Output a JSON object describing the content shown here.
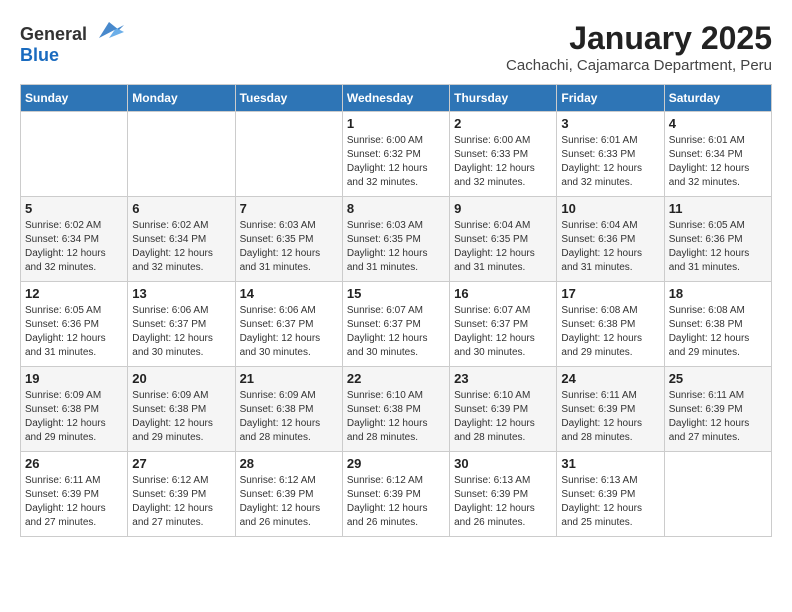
{
  "header": {
    "logo_general": "General",
    "logo_blue": "Blue",
    "month_title": "January 2025",
    "location": "Cachachi, Cajamarca Department, Peru"
  },
  "days_of_week": [
    "Sunday",
    "Monday",
    "Tuesday",
    "Wednesday",
    "Thursday",
    "Friday",
    "Saturday"
  ],
  "weeks": [
    [
      {
        "day": "",
        "info": ""
      },
      {
        "day": "",
        "info": ""
      },
      {
        "day": "",
        "info": ""
      },
      {
        "day": "1",
        "info": "Sunrise: 6:00 AM\nSunset: 6:32 PM\nDaylight: 12 hours\nand 32 minutes."
      },
      {
        "day": "2",
        "info": "Sunrise: 6:00 AM\nSunset: 6:33 PM\nDaylight: 12 hours\nand 32 minutes."
      },
      {
        "day": "3",
        "info": "Sunrise: 6:01 AM\nSunset: 6:33 PM\nDaylight: 12 hours\nand 32 minutes."
      },
      {
        "day": "4",
        "info": "Sunrise: 6:01 AM\nSunset: 6:34 PM\nDaylight: 12 hours\nand 32 minutes."
      }
    ],
    [
      {
        "day": "5",
        "info": "Sunrise: 6:02 AM\nSunset: 6:34 PM\nDaylight: 12 hours\nand 32 minutes."
      },
      {
        "day": "6",
        "info": "Sunrise: 6:02 AM\nSunset: 6:34 PM\nDaylight: 12 hours\nand 32 minutes."
      },
      {
        "day": "7",
        "info": "Sunrise: 6:03 AM\nSunset: 6:35 PM\nDaylight: 12 hours\nand 31 minutes."
      },
      {
        "day": "8",
        "info": "Sunrise: 6:03 AM\nSunset: 6:35 PM\nDaylight: 12 hours\nand 31 minutes."
      },
      {
        "day": "9",
        "info": "Sunrise: 6:04 AM\nSunset: 6:35 PM\nDaylight: 12 hours\nand 31 minutes."
      },
      {
        "day": "10",
        "info": "Sunrise: 6:04 AM\nSunset: 6:36 PM\nDaylight: 12 hours\nand 31 minutes."
      },
      {
        "day": "11",
        "info": "Sunrise: 6:05 AM\nSunset: 6:36 PM\nDaylight: 12 hours\nand 31 minutes."
      }
    ],
    [
      {
        "day": "12",
        "info": "Sunrise: 6:05 AM\nSunset: 6:36 PM\nDaylight: 12 hours\nand 31 minutes."
      },
      {
        "day": "13",
        "info": "Sunrise: 6:06 AM\nSunset: 6:37 PM\nDaylight: 12 hours\nand 30 minutes."
      },
      {
        "day": "14",
        "info": "Sunrise: 6:06 AM\nSunset: 6:37 PM\nDaylight: 12 hours\nand 30 minutes."
      },
      {
        "day": "15",
        "info": "Sunrise: 6:07 AM\nSunset: 6:37 PM\nDaylight: 12 hours\nand 30 minutes."
      },
      {
        "day": "16",
        "info": "Sunrise: 6:07 AM\nSunset: 6:37 PM\nDaylight: 12 hours\nand 30 minutes."
      },
      {
        "day": "17",
        "info": "Sunrise: 6:08 AM\nSunset: 6:38 PM\nDaylight: 12 hours\nand 29 minutes."
      },
      {
        "day": "18",
        "info": "Sunrise: 6:08 AM\nSunset: 6:38 PM\nDaylight: 12 hours\nand 29 minutes."
      }
    ],
    [
      {
        "day": "19",
        "info": "Sunrise: 6:09 AM\nSunset: 6:38 PM\nDaylight: 12 hours\nand 29 minutes."
      },
      {
        "day": "20",
        "info": "Sunrise: 6:09 AM\nSunset: 6:38 PM\nDaylight: 12 hours\nand 29 minutes."
      },
      {
        "day": "21",
        "info": "Sunrise: 6:09 AM\nSunset: 6:38 PM\nDaylight: 12 hours\nand 28 minutes."
      },
      {
        "day": "22",
        "info": "Sunrise: 6:10 AM\nSunset: 6:38 PM\nDaylight: 12 hours\nand 28 minutes."
      },
      {
        "day": "23",
        "info": "Sunrise: 6:10 AM\nSunset: 6:39 PM\nDaylight: 12 hours\nand 28 minutes."
      },
      {
        "day": "24",
        "info": "Sunrise: 6:11 AM\nSunset: 6:39 PM\nDaylight: 12 hours\nand 28 minutes."
      },
      {
        "day": "25",
        "info": "Sunrise: 6:11 AM\nSunset: 6:39 PM\nDaylight: 12 hours\nand 27 minutes."
      }
    ],
    [
      {
        "day": "26",
        "info": "Sunrise: 6:11 AM\nSunset: 6:39 PM\nDaylight: 12 hours\nand 27 minutes."
      },
      {
        "day": "27",
        "info": "Sunrise: 6:12 AM\nSunset: 6:39 PM\nDaylight: 12 hours\nand 27 minutes."
      },
      {
        "day": "28",
        "info": "Sunrise: 6:12 AM\nSunset: 6:39 PM\nDaylight: 12 hours\nand 26 minutes."
      },
      {
        "day": "29",
        "info": "Sunrise: 6:12 AM\nSunset: 6:39 PM\nDaylight: 12 hours\nand 26 minutes."
      },
      {
        "day": "30",
        "info": "Sunrise: 6:13 AM\nSunset: 6:39 PM\nDaylight: 12 hours\nand 26 minutes."
      },
      {
        "day": "31",
        "info": "Sunrise: 6:13 AM\nSunset: 6:39 PM\nDaylight: 12 hours\nand 25 minutes."
      },
      {
        "day": "",
        "info": ""
      }
    ]
  ]
}
